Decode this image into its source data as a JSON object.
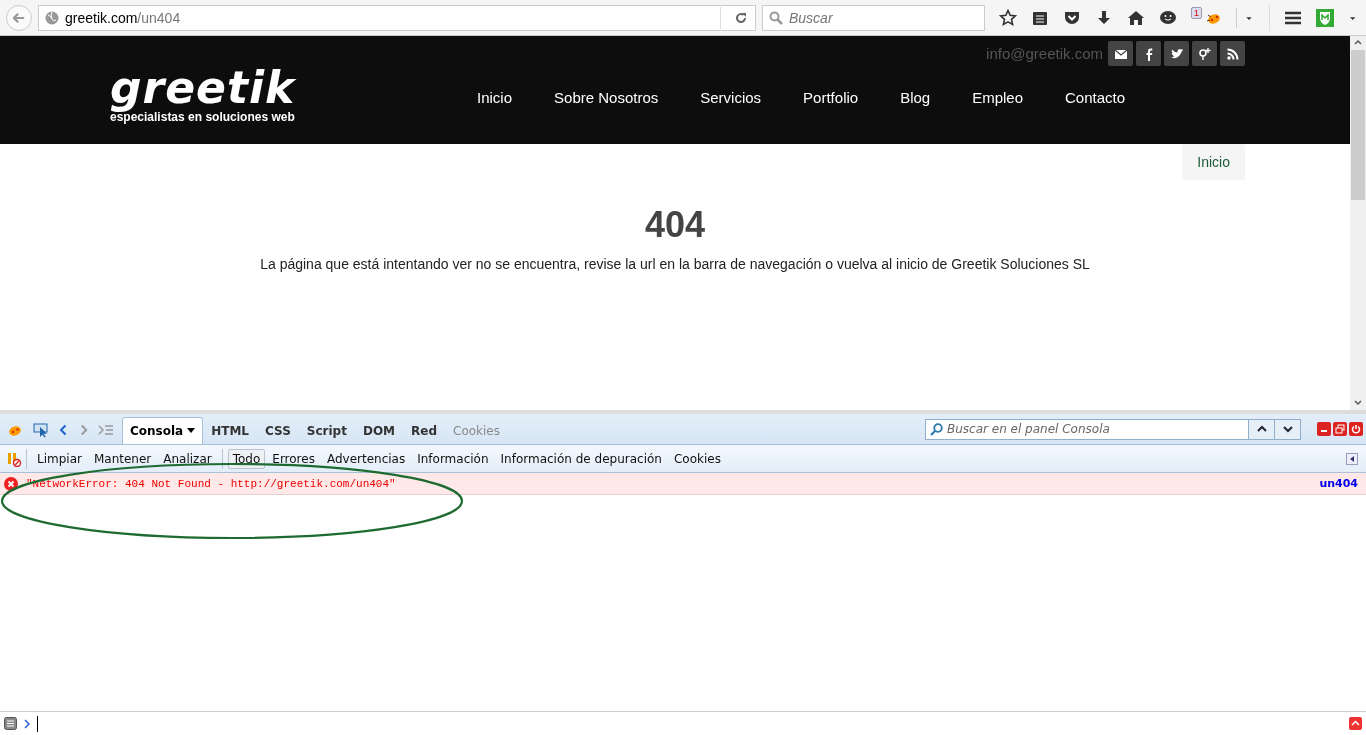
{
  "browser": {
    "url": {
      "host": "greetik.com",
      "path": "/un404"
    },
    "search": {
      "placeholder": "Buscar"
    },
    "notification_count": "1"
  },
  "site": {
    "logo": "greetik",
    "tagline": "especialistas en soluciones web",
    "email": "info@greetik.com",
    "nav": [
      "Inicio",
      "Sobre Nosotros",
      "Servicios",
      "Portfolio",
      "Blog",
      "Empleo",
      "Contacto"
    ],
    "breadcrumb": "Inicio",
    "error_code": "404",
    "message": "La página que está intentando ver no se encuentra, revise la url en la barra de navegación o vuelva al inicio de Greetik Soluciones SL"
  },
  "devtools": {
    "tabs": [
      {
        "label": "Consola",
        "selected": true,
        "disabled": false
      },
      {
        "label": "HTML",
        "selected": false,
        "disabled": false
      },
      {
        "label": "CSS",
        "selected": false,
        "disabled": false
      },
      {
        "label": "Script",
        "selected": false,
        "disabled": false
      },
      {
        "label": "DOM",
        "selected": false,
        "disabled": false
      },
      {
        "label": "Red",
        "selected": false,
        "disabled": false
      },
      {
        "label": "Cookies",
        "selected": false,
        "disabled": true
      }
    ],
    "search": {
      "placeholder": "Buscar en el panel Consola"
    },
    "actions": [
      "Limpiar",
      "Mantener",
      "Analizar"
    ],
    "filters": [
      {
        "label": "Todo",
        "selected": true
      },
      {
        "label": "Errores",
        "selected": false
      },
      {
        "label": "Advertencias",
        "selected": false
      },
      {
        "label": "Información",
        "selected": false
      },
      {
        "label": "Información de depuración",
        "selected": false
      },
      {
        "label": "Cookies",
        "selected": false
      }
    ],
    "log": [
      {
        "kind": "error",
        "message": "\"NetworkError: 404 Not Found - http://greetik.com/un404\"",
        "source": "un404"
      }
    ]
  }
}
